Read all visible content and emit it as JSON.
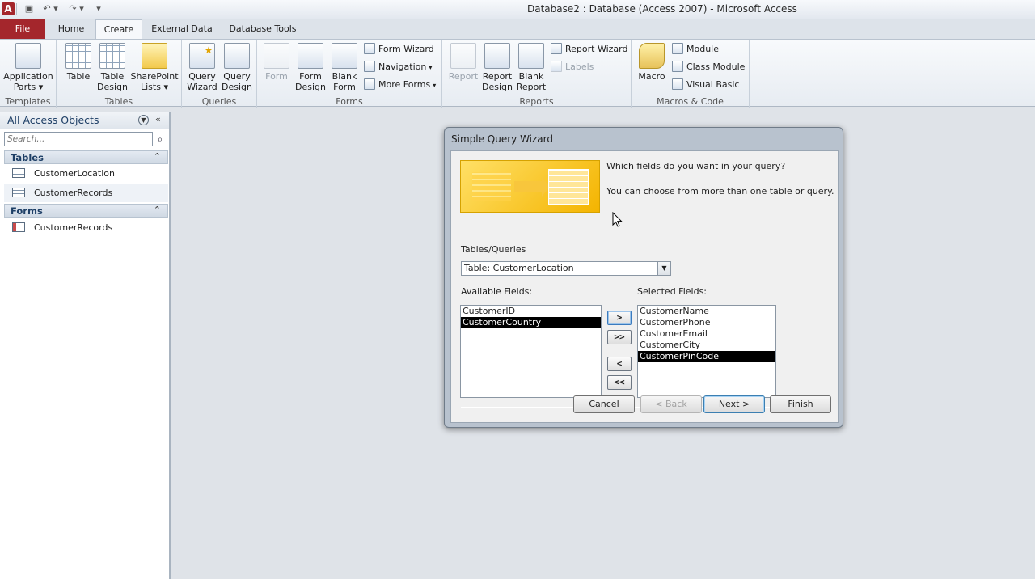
{
  "window": {
    "title": "Database2 : Database (Access 2007)  -  Microsoft Access"
  },
  "tabs": [
    "File",
    "Home",
    "Create",
    "External Data",
    "Database Tools"
  ],
  "ribbon": {
    "templates": {
      "label": "Templates",
      "app_parts": "Application",
      "app_parts2": "Parts ▾"
    },
    "tables": {
      "label": "Tables",
      "table": "Table",
      "table_design1": "Table",
      "table_design2": "Design",
      "sharepoint1": "SharePoint",
      "sharepoint2": "Lists ▾"
    },
    "queries": {
      "label": "Queries",
      "wizard1": "Query",
      "wizard2": "Wizard",
      "design1": "Query",
      "design2": "Design"
    },
    "forms": {
      "label": "Forms",
      "form": "Form",
      "form_design1": "Form",
      "form_design2": "Design",
      "blank1": "Blank",
      "blank2": "Form",
      "wizard": "Form Wizard",
      "navigation": "Navigation",
      "more": "More Forms"
    },
    "reports": {
      "label": "Reports",
      "report": "Report",
      "design1": "Report",
      "design2": "Design",
      "blank1": "Blank",
      "blank2": "Report",
      "wizard": "Report Wizard",
      "labels": "Labels"
    },
    "macros": {
      "label": "Macros & Code",
      "macro": "Macro",
      "module": "Module",
      "class_module": "Class Module",
      "vb": "Visual Basic"
    }
  },
  "nav": {
    "title": "All Access Objects",
    "search_placeholder": "Search...",
    "sections": [
      {
        "label": "Tables",
        "items": [
          "CustomerLocation",
          "CustomerRecords"
        ]
      },
      {
        "label": "Forms",
        "items": [
          "CustomerRecords"
        ]
      }
    ]
  },
  "dialog": {
    "title": "Simple Query Wizard",
    "q1": "Which fields do you want in your query?",
    "q2": "You can choose from more than one table or query.",
    "tables_label": "Tables/Queries",
    "table_value": "Table: CustomerLocation",
    "available_label": "Available Fields:",
    "selected_label": "Selected Fields:",
    "available": [
      "CustomerID",
      "CustomerCountry"
    ],
    "selected": [
      "CustomerName",
      "CustomerPhone",
      "CustomerEmail",
      "CustomerCity",
      "CustomerPinCode"
    ],
    "move_one": ">",
    "move_all": ">>",
    "remove_one": "<",
    "remove_all": "<<",
    "cancel": "Cancel",
    "back": "< Back",
    "next": "Next >",
    "finish": "Finish"
  }
}
